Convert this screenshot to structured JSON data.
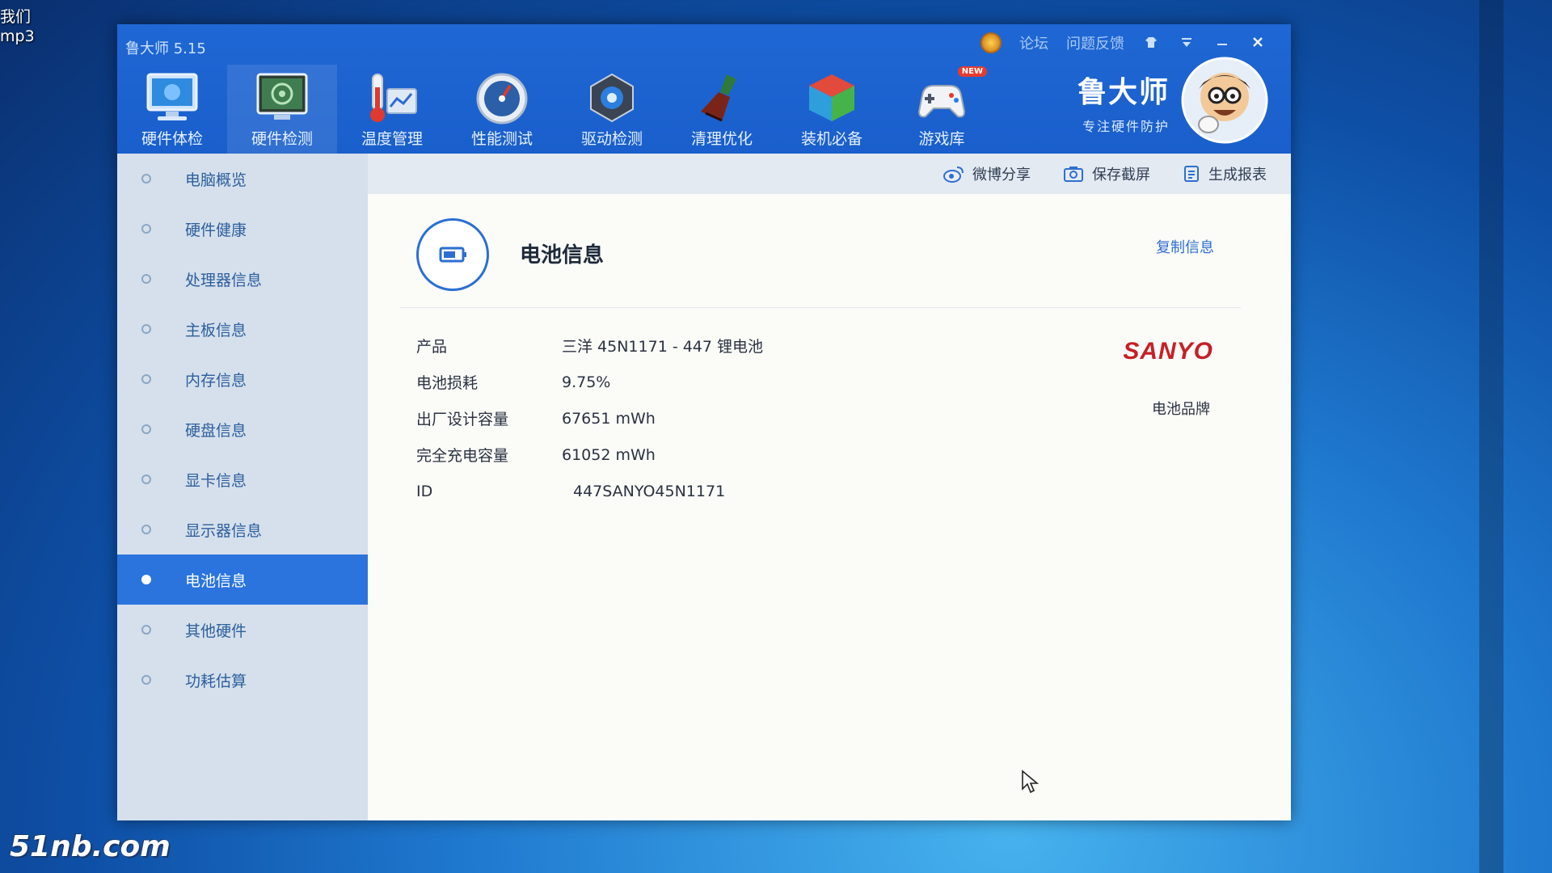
{
  "desktop": {
    "labels": [
      "我们",
      "mp3"
    ],
    "watermark": "51nb.com"
  },
  "app": {
    "title": "鲁大师 5.15",
    "top_links": [
      "论坛",
      "问题反馈"
    ],
    "controls": [
      "skin-icon",
      "menu-icon",
      "minimize-icon",
      "close-icon"
    ],
    "brand_name": "鲁大师",
    "brand_slogan": "专注硬件防护"
  },
  "nav": {
    "items": [
      {
        "label": "硬件体检",
        "icon": "monitor-icon"
      },
      {
        "label": "硬件检测",
        "icon": "motherboard-icon"
      },
      {
        "label": "温度管理",
        "icon": "thermometer-icon"
      },
      {
        "label": "性能测试",
        "icon": "speedometer-icon"
      },
      {
        "label": "驱动检测",
        "icon": "gear-icon"
      },
      {
        "label": "清理优化",
        "icon": "broom-icon"
      },
      {
        "label": "装机必备",
        "icon": "cube-icon"
      },
      {
        "label": "游戏库",
        "icon": "gamepad-icon",
        "badge": "NEW"
      }
    ],
    "active_index": 1
  },
  "sidebar": {
    "items": [
      {
        "label": "电脑概览"
      },
      {
        "label": "硬件健康"
      },
      {
        "label": "处理器信息"
      },
      {
        "label": "主板信息"
      },
      {
        "label": "内存信息"
      },
      {
        "label": "硬盘信息"
      },
      {
        "label": "显卡信息"
      },
      {
        "label": "显示器信息"
      },
      {
        "label": "电池信息"
      },
      {
        "label": "其他硬件"
      },
      {
        "label": "功耗估算"
      }
    ],
    "active_index": 8
  },
  "toolbar": {
    "weibo_share": "微博分享",
    "save_screenshot": "保存截屏",
    "generate_report": "生成报表"
  },
  "battery": {
    "section_title": "电池信息",
    "copy_label": "复制信息",
    "rows": [
      {
        "key": "产品",
        "value": "三洋 45N1171 -   447 锂电池"
      },
      {
        "key": "电池损耗",
        "value": "9.75%"
      },
      {
        "key": "出厂设计容量",
        "value": "67651 mWh"
      },
      {
        "key": "完全充电容量",
        "value": "61052 mWh"
      },
      {
        "key": "ID",
        "value": "447SANYO45N1171"
      }
    ],
    "brand_logo": "SANYO",
    "brand_caption": "电池品牌"
  },
  "colors": {
    "accent": "#2b74de",
    "topbar": "#1f67d4",
    "sidebar": "#d5e0ec",
    "logo_red": "#c62027"
  }
}
